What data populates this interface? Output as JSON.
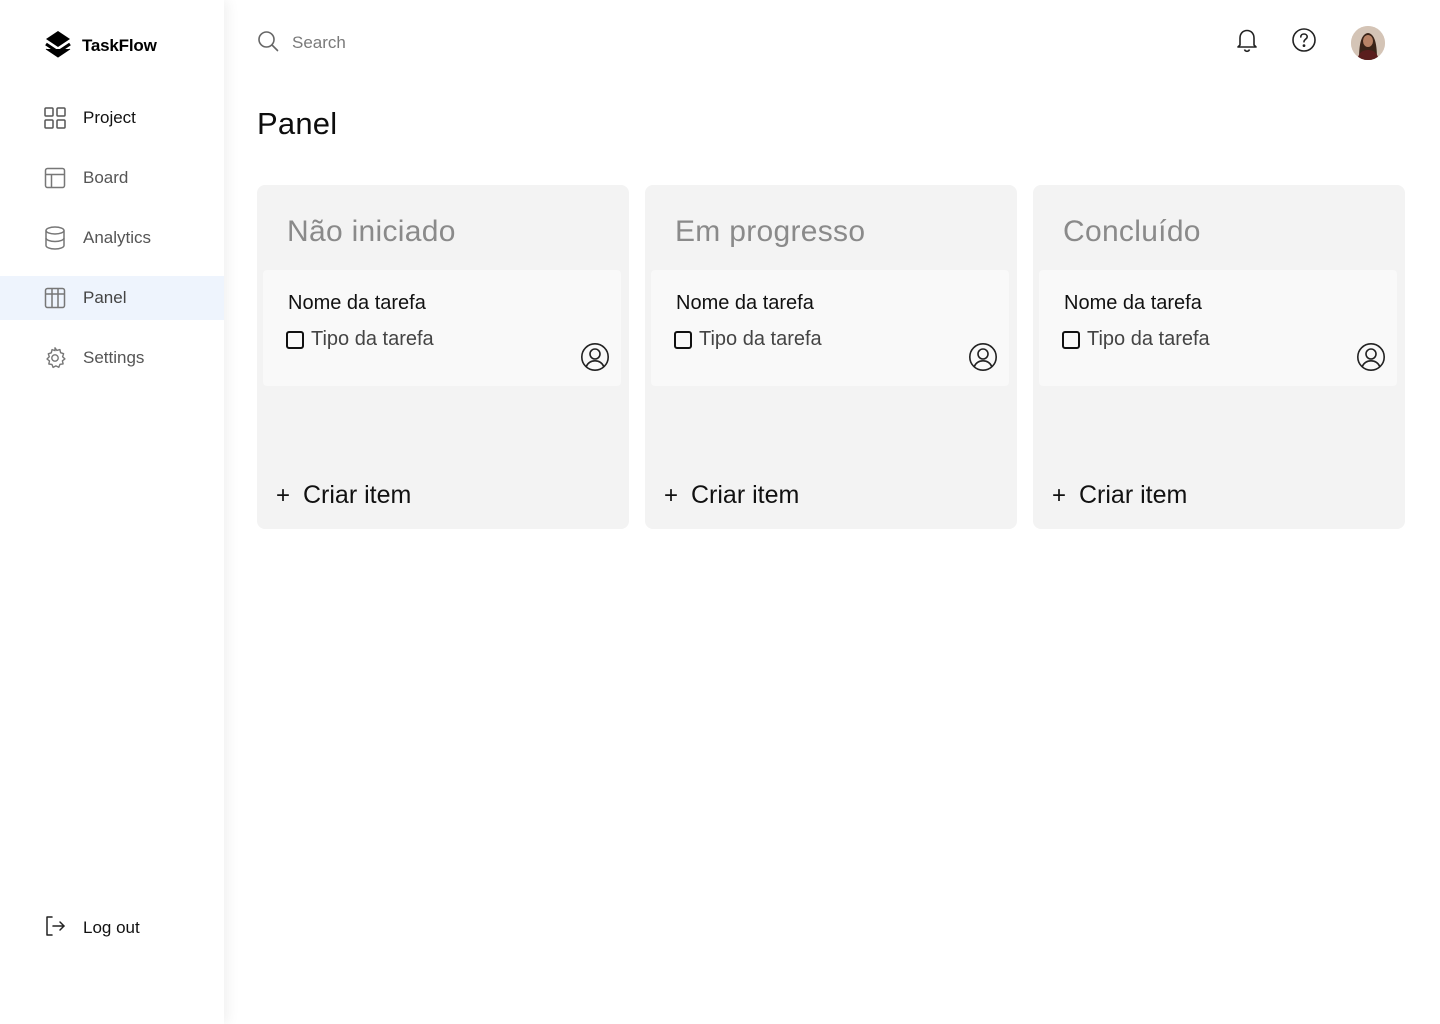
{
  "brand": {
    "name": "TaskFlow",
    "logo_icon": "stack-layers-icon"
  },
  "sidebar": {
    "items": [
      {
        "label": "Project",
        "icon": "grid-icon",
        "active": false
      },
      {
        "label": "Board",
        "icon": "layout-icon",
        "active": false
      },
      {
        "label": "Analytics",
        "icon": "database-icon",
        "active": false
      },
      {
        "label": "Panel",
        "icon": "table-icon",
        "active": true
      },
      {
        "label": "Settings",
        "icon": "gear-icon",
        "active": false
      }
    ],
    "logout_label": "Log out",
    "active_bg": "#eef4fd"
  },
  "topbar": {
    "search_placeholder": "Search",
    "icons": [
      "bell-icon",
      "help-icon",
      "avatar"
    ]
  },
  "page": {
    "title": "Panel"
  },
  "columns": [
    {
      "title": "Não iniciado",
      "cards": [
        {
          "name": "Nome da tarefa",
          "type": "Tipo da tarefa",
          "checked": false
        }
      ],
      "create_label": "Criar item"
    },
    {
      "title": "Em progresso",
      "cards": [
        {
          "name": "Nome da tarefa",
          "type": "Tipo da tarefa",
          "checked": false
        }
      ],
      "create_label": "Criar item"
    },
    {
      "title": "Concluído",
      "cards": [
        {
          "name": "Nome da tarefa",
          "type": "Tipo da tarefa",
          "checked": false
        }
      ],
      "create_label": "Criar item"
    }
  ],
  "colors": {
    "column_bg": "#f3f3f3",
    "card_bg": "#f9f9f9",
    "column_title": "#8a8a8a",
    "text": "#111111"
  }
}
